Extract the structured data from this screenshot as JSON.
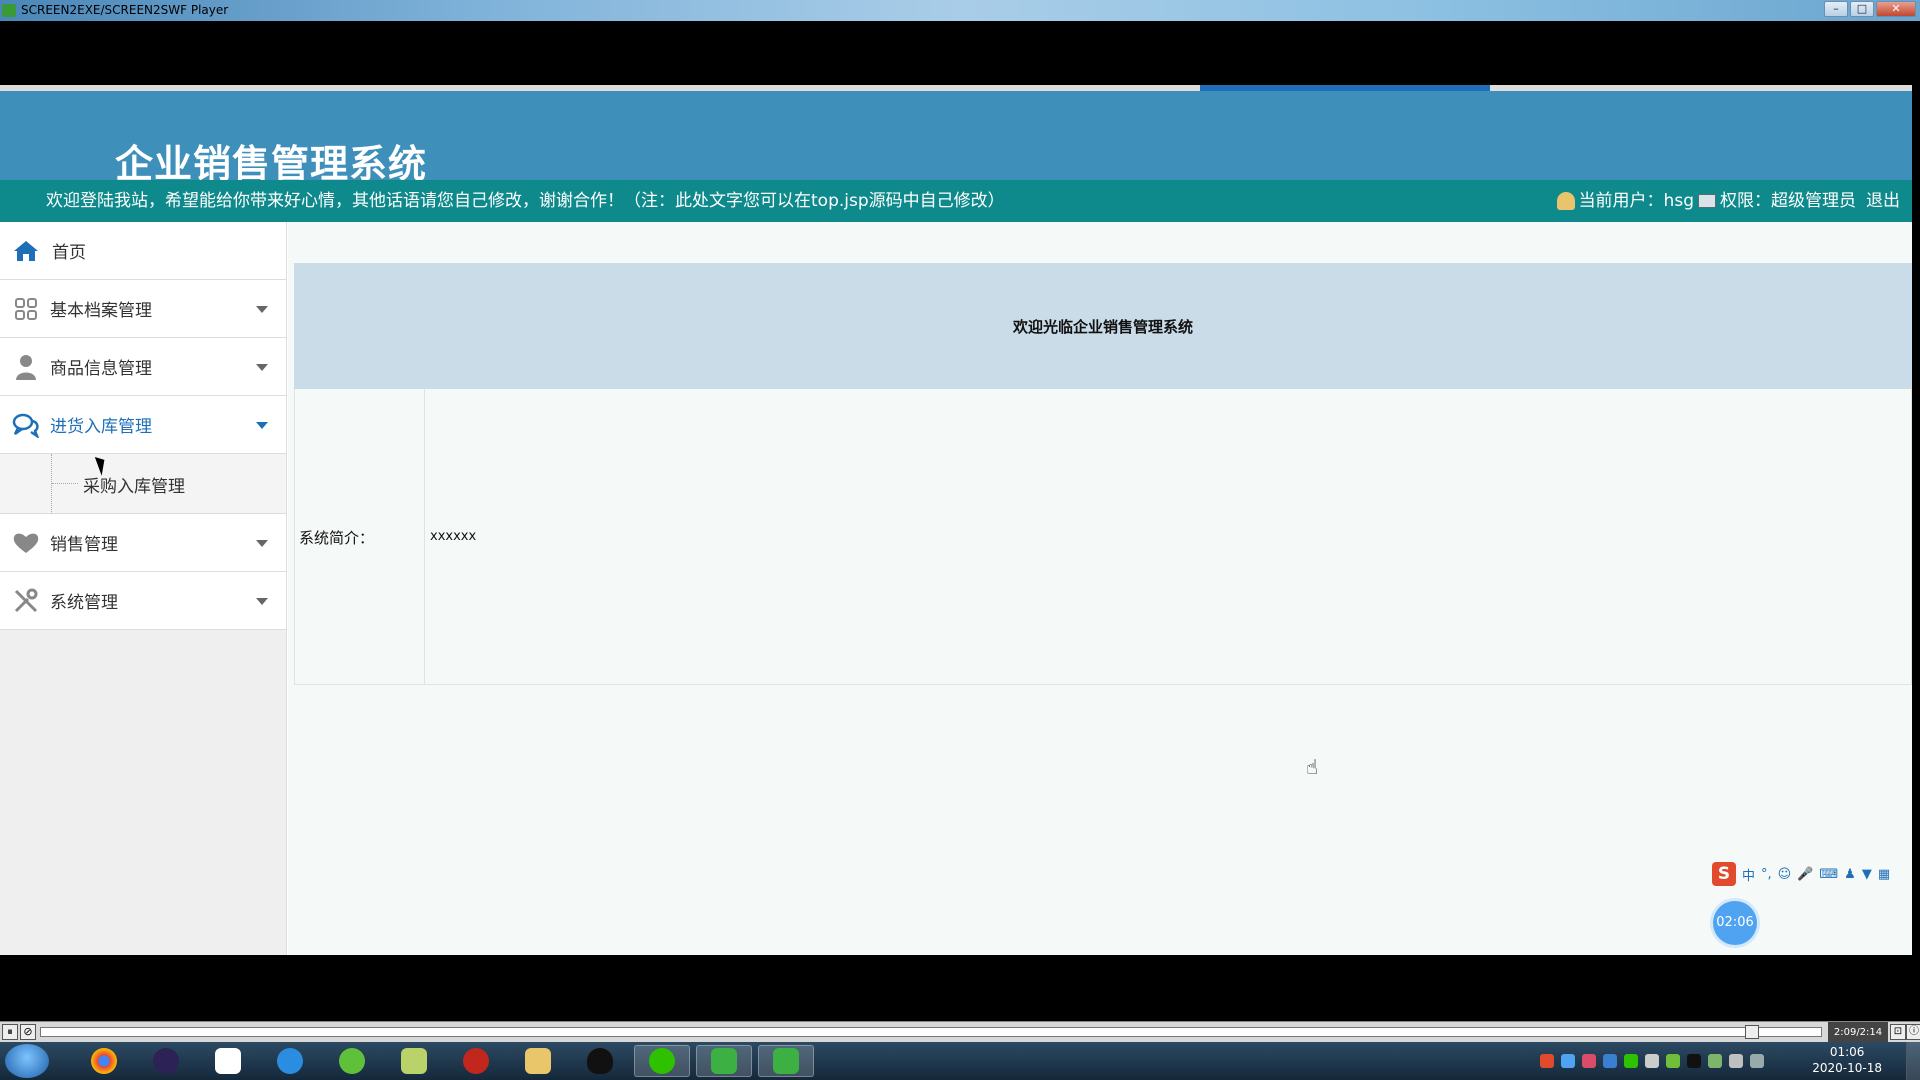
{
  "window": {
    "title": "SCREEN2EXE/SCREEN2SWF Player",
    "buttons": [
      "–",
      "□",
      "✕"
    ]
  },
  "header": {
    "system_title": "企业销售管理系统",
    "welcome_text": "欢迎登陆我站，希望能给你带来好心情，其他话语请您自己修改，谢谢合作！（注：此处文字您可以在top.jsp源码中自己修改）",
    "current_user_label": "当前用户：hsg",
    "permission_label": "权限：超级管理员",
    "logout_label": "退出"
  },
  "sidebar": {
    "items": [
      {
        "label": "首页",
        "icon": "home-icon"
      },
      {
        "label": "基本档案管理",
        "icon": "grid-icon"
      },
      {
        "label": "商品信息管理",
        "icon": "user-icon"
      },
      {
        "label": "进货入库管理",
        "icon": "chat-icon",
        "expanded": true
      },
      {
        "label": "销售管理",
        "icon": "heart-icon"
      },
      {
        "label": "系统管理",
        "icon": "tools-icon"
      }
    ],
    "subitems": [
      {
        "label": "采购入库管理"
      }
    ]
  },
  "main": {
    "welcome_heading": "欢迎光临企业销售管理系统",
    "intro_label": "系统简介：",
    "intro_value": "xxxxxx"
  },
  "overlay": {
    "timer": "02:06",
    "ime_mode": "中"
  },
  "player": {
    "time": "2:09/2:14",
    "play_progress": 0.98
  },
  "taskbar": {
    "apps": [
      "chrome-icon",
      "eclipse-icon",
      "baidu-netdisk-icon",
      "qq-browser-icon",
      "360-icon",
      "editor-icon",
      "flash-icon",
      "file-explorer-icon",
      "qq-icon",
      "wechat-icon",
      "video-player-icon",
      "video-player-icon-2"
    ],
    "clock_time": "01:06",
    "clock_date": "2020-10-18"
  },
  "colors": {
    "header_bg": "#3f8fbb",
    "infobar_bg": "#0f8a8c",
    "accent": "#1e6fb7",
    "welcome_box_bg": "#c9dce7"
  }
}
